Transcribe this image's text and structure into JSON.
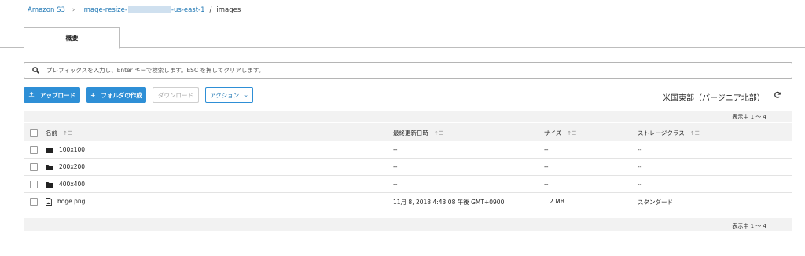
{
  "breadcrumb": {
    "root": "Amazon S3",
    "bucket_prefix": "image-resize-",
    "bucket_suffix": "-us-east-1",
    "separator": "/",
    "current": "images"
  },
  "tab": {
    "label": "概要"
  },
  "search": {
    "placeholder": "プレフィックスを入力し、Enter キーで検索します。ESC を押してクリアします。"
  },
  "toolbar": {
    "upload_label": "アップロード",
    "create_folder_label": "フォルダの作成",
    "download_label": "ダウンロード",
    "actions_label": "アクション",
    "region_label": "米国東部（バージニア北部）"
  },
  "table": {
    "count_top": "表示中 1 ～ 4",
    "count_bottom": "表示中 1 ～ 4",
    "columns": [
      "名前",
      "最終更新日時",
      "サイズ",
      "ストレージクラス"
    ],
    "rows": [
      {
        "name": "100x100",
        "type": "folder",
        "modified": "--",
        "size": "--",
        "storage": "--"
      },
      {
        "name": "200x200",
        "type": "folder",
        "modified": "--",
        "size": "--",
        "storage": "--"
      },
      {
        "name": "400x400",
        "type": "folder",
        "modified": "--",
        "size": "--",
        "storage": "--"
      },
      {
        "name": "hoge.png",
        "type": "file",
        "modified": "11月 8, 2018 4:43:08 午後 GMT+0900",
        "size": "1.2 MB",
        "storage": "スタンダード"
      }
    ]
  },
  "colors": {
    "accent": "#2e8fd6",
    "link": "#1f77b4",
    "band": "#f2f2f2"
  }
}
